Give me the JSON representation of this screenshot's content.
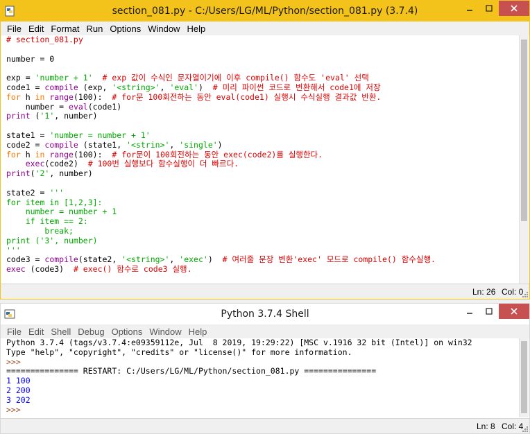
{
  "editor": {
    "title": "section_081.py - C:/Users/LG/ML/Python/section_081.py (3.7.4)",
    "menu": [
      "File",
      "Edit",
      "Format",
      "Run",
      "Options",
      "Window",
      "Help"
    ],
    "lines": [
      [
        [
          "# section_081.py",
          "comment"
        ]
      ],
      [],
      [
        [
          "number = 0",
          "plain"
        ]
      ],
      [],
      [
        [
          "exp = ",
          "plain"
        ],
        [
          "'number + 1'",
          "string"
        ],
        [
          "  ",
          "plain"
        ],
        [
          "# exp 값이 수식인 문자열이기에 이후 compile() 함수도 'eval' 선택",
          "comment"
        ]
      ],
      [
        [
          "code1 = ",
          "plain"
        ],
        [
          "compile",
          "builtin"
        ],
        [
          " (exp, ",
          "plain"
        ],
        [
          "'<string>'",
          "string"
        ],
        [
          ", ",
          "plain"
        ],
        [
          "'eval'",
          "string"
        ],
        [
          ")  ",
          "plain"
        ],
        [
          "# 미리 파이썬 코드로 변환해서 code1에 저장",
          "comment"
        ]
      ],
      [
        [
          "for",
          "keyword"
        ],
        [
          " h ",
          "plain"
        ],
        [
          "in",
          "keyword"
        ],
        [
          " ",
          "plain"
        ],
        [
          "range",
          "builtin"
        ],
        [
          "(100):  ",
          "plain"
        ],
        [
          "# for문 100회전하는 동안 eval(code1) 실행시 수식실행 결과값 반환.",
          "comment"
        ]
      ],
      [
        [
          "    number = ",
          "plain"
        ],
        [
          "eval",
          "builtin"
        ],
        [
          "(code1)",
          "plain"
        ]
      ],
      [
        [
          "print",
          "builtin"
        ],
        [
          " (",
          "plain"
        ],
        [
          "'1'",
          "string"
        ],
        [
          ", number)",
          "plain"
        ]
      ],
      [],
      [
        [
          "state1 = ",
          "plain"
        ],
        [
          "'number = number + 1'",
          "string"
        ]
      ],
      [
        [
          "code2 = ",
          "plain"
        ],
        [
          "compile",
          "builtin"
        ],
        [
          " (state1, ",
          "plain"
        ],
        [
          "'<strin>'",
          "string"
        ],
        [
          ", ",
          "plain"
        ],
        [
          "'single'",
          "string"
        ],
        [
          ")",
          "plain"
        ]
      ],
      [
        [
          "for",
          "keyword"
        ],
        [
          " h ",
          "plain"
        ],
        [
          "in",
          "keyword"
        ],
        [
          " ",
          "plain"
        ],
        [
          "range",
          "builtin"
        ],
        [
          "(100):  ",
          "plain"
        ],
        [
          "# for문이 100회전하는 동안 exec(code2)를 실행한다.",
          "comment"
        ]
      ],
      [
        [
          "    ",
          "plain"
        ],
        [
          "exec",
          "builtin"
        ],
        [
          "(code2)  ",
          "plain"
        ],
        [
          "# 100번 실행보다 함수실행이 더 빠르다.",
          "comment"
        ]
      ],
      [
        [
          "print",
          "builtin"
        ],
        [
          "(",
          "plain"
        ],
        [
          "'2'",
          "string"
        ],
        [
          ", number)",
          "plain"
        ]
      ],
      [],
      [
        [
          "state2 = ",
          "plain"
        ],
        [
          "'''",
          "string"
        ]
      ],
      [
        [
          "for item in [1,2,3]:",
          "string"
        ]
      ],
      [
        [
          "    number = number + 1",
          "string"
        ]
      ],
      [
        [
          "    if item == 2:",
          "string"
        ]
      ],
      [
        [
          "        break;",
          "string"
        ]
      ],
      [
        [
          "print ('3', number)",
          "string"
        ]
      ],
      [
        [
          "'''",
          "string"
        ]
      ],
      [
        [
          "code3 = ",
          "plain"
        ],
        [
          "compile",
          "builtin"
        ],
        [
          "(state2, ",
          "plain"
        ],
        [
          "'<string>'",
          "string"
        ],
        [
          ", ",
          "plain"
        ],
        [
          "'exec'",
          "string"
        ],
        [
          ")  ",
          "plain"
        ],
        [
          "# 여러줄 문장 변환'exec' 모드로 compile() 함수실행.",
          "comment"
        ]
      ],
      [
        [
          "exec",
          "builtin"
        ],
        [
          " (code3)  ",
          "plain"
        ],
        [
          "# exec() 함수로 code3 실행.",
          "comment"
        ]
      ]
    ],
    "status": {
      "line": "Ln: 26",
      "col": "Col: 0"
    }
  },
  "shell": {
    "title": "Python 3.7.4 Shell",
    "menu": [
      "File",
      "Edit",
      "Shell",
      "Debug",
      "Options",
      "Window",
      "Help"
    ],
    "lines": [
      [
        [
          "Python 3.7.4 (tags/v3.7.4:e09359112e, Jul  8 2019, 19:29:22) [MSC v.1916 32 bit (Intel)] on win32",
          "plain"
        ]
      ],
      [
        [
          "Type \"help\", \"copyright\", \"credits\" or \"license()\" for more information.",
          "plain"
        ]
      ],
      [
        [
          ">>> ",
          "prompt"
        ]
      ],
      [
        [
          "=============== RESTART: C:/Users/LG/ML/Python/section_081.py ===============",
          "plain"
        ]
      ],
      [
        [
          "1 100",
          "out"
        ]
      ],
      [
        [
          "2 200",
          "out"
        ]
      ],
      [
        [
          "3 202",
          "out"
        ]
      ],
      [
        [
          ">>> ",
          "prompt"
        ]
      ]
    ],
    "status": {
      "line": "Ln: 8",
      "col": "Col: 4"
    }
  },
  "icons": {
    "editor_app": "python-file-icon",
    "shell_app": "python-shell-icon",
    "minimize": "minimize-icon",
    "maximize": "maximize-icon",
    "close": "close-icon"
  },
  "colors": {
    "editor_title_bg": "#f3c21b",
    "comment": "#dd0000",
    "keyword": "#ff7700",
    "builtin": "#900090",
    "string": "#00aa00",
    "output": "#0000ff"
  }
}
